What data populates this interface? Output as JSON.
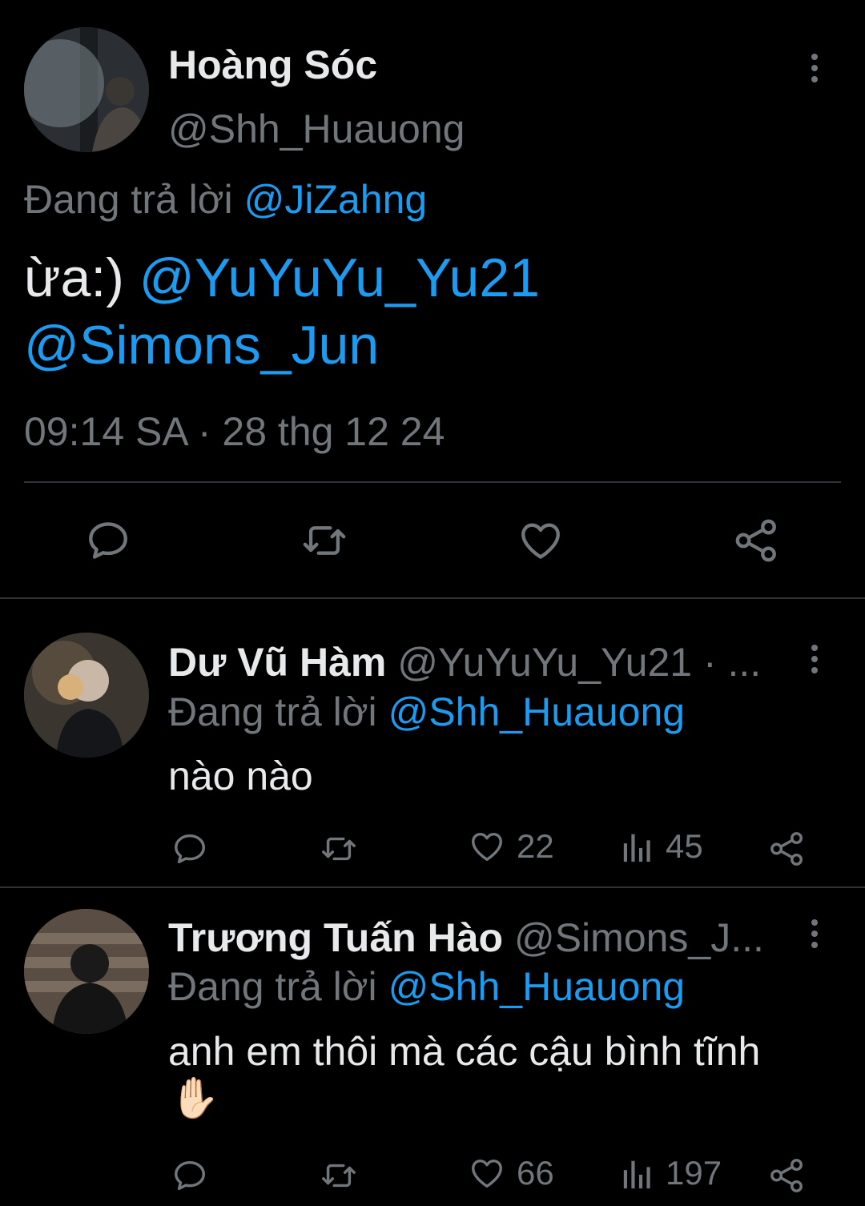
{
  "main_tweet": {
    "display_name": "Hoàng Sóc",
    "handle": "@Shh_Huauong",
    "reply_prefix": "Đang trả lời",
    "reply_to": "@JiZahng",
    "text": "ừa:)",
    "mention_1": "@YuYuYu_Yu21",
    "mention_2": "@Simons_Jun",
    "timestamp": "09:14 SA · 28 thg 12 24"
  },
  "replies": [
    {
      "display_name": "Dư Vũ Hàm",
      "handle": "@YuYuYu_Yu21 · ...",
      "reply_prefix": "Đang trả lời",
      "reply_to": "@Shh_Huauong",
      "text": "nào nào",
      "likes": "22",
      "views": "45"
    },
    {
      "display_name": "Trương Tuấn Hào",
      "handle": "@Simons_J...",
      "reply_prefix": "Đang trả lời",
      "reply_to": "@Shh_Huauong",
      "text": "anh em thôi mà các cậu bình tĩnh",
      "emoji": "✋🏻",
      "likes": "66",
      "views": "197"
    }
  ],
  "colors": {
    "background": "#000000",
    "text": "#e7e9ea",
    "secondary": "#71767b",
    "accent": "#1d9bf0",
    "divider": "#2f3336"
  },
  "icons": [
    "more-icon",
    "reply-icon",
    "retweet-icon",
    "like-icon",
    "share-icon",
    "views-icon"
  ]
}
